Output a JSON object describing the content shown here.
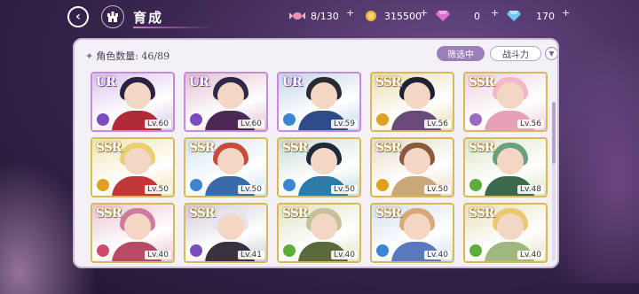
{
  "header": {
    "title": "育成",
    "resources": [
      {
        "name": "candy",
        "icon": "candy-icon",
        "value": "8/130",
        "color": "#f08fb0"
      },
      {
        "name": "gold",
        "icon": "gold-coin-icon",
        "value": "315500",
        "color": "#e8b53a"
      },
      {
        "name": "gem-pink",
        "icon": "pink-diamond-icon",
        "value": "0",
        "color": "#e070d0"
      },
      {
        "name": "gem-blue",
        "icon": "blue-diamond-icon",
        "value": "170",
        "color": "#6cc8f0"
      }
    ],
    "plus": "+"
  },
  "panel": {
    "count_label": "角色数量: 46/89",
    "filter_label": "筛选中",
    "power_label": "战斗力"
  },
  "cards": [
    {
      "rarity": "UR",
      "level": "Lv.60",
      "element": "#7a4cc0",
      "bg": "#d9c4ea",
      "hair": "#2a2240",
      "outfit": "#b02a3a"
    },
    {
      "rarity": "UR",
      "level": "Lv.60",
      "element": "#7a4cc0",
      "bg": "#e2c0d0",
      "hair": "#30284a",
      "outfit": "#4a2a55"
    },
    {
      "rarity": "UR",
      "level": "Lv.59",
      "element": "#3a86d0",
      "bg": "#c4d4ea",
      "hair": "#2a2a30",
      "outfit": "#2e4c8a"
    },
    {
      "rarity": "SSR",
      "level": "Lv.56",
      "element": "#e0a020",
      "bg": "#e8dcae",
      "hair": "#1e2230",
      "outfit": "#6a4a7a"
    },
    {
      "rarity": "SSR",
      "level": "Lv.56",
      "element": "#9a6ac0",
      "bg": "#ecd2dc",
      "hair": "#f4b6c8",
      "outfit": "#e6a0b8"
    },
    {
      "rarity": "SSR",
      "level": "Lv.50",
      "element": "#e0a020",
      "bg": "#efe4b4",
      "hair": "#e8d070",
      "outfit": "#c23838"
    },
    {
      "rarity": "SSR",
      "level": "Lv.50",
      "element": "#3a86d0",
      "bg": "#d2e4f0",
      "hair": "#c84a3a",
      "outfit": "#3a6aa8"
    },
    {
      "rarity": "SSR",
      "level": "Lv.50",
      "element": "#3a86d0",
      "bg": "#c8dcd8",
      "hair": "#1c2a3a",
      "outfit": "#2c7aa8"
    },
    {
      "rarity": "SSR",
      "level": "Lv.50",
      "element": "#e0a020",
      "bg": "#e6dcc4",
      "hair": "#8a5a3a",
      "outfit": "#c8a878"
    },
    {
      "rarity": "SSR",
      "level": "Lv.48",
      "element": "#5cae3a",
      "bg": "#dce6c8",
      "hair": "#6aa080",
      "outfit": "#3a6a4a"
    },
    {
      "rarity": "SSR",
      "level": "Lv.40",
      "element": "#d04a6a",
      "bg": "#e8c4d4",
      "hair": "#d07aa0",
      "outfit": "#b84a68"
    },
    {
      "rarity": "SSR",
      "level": "Lv.41",
      "element": "#7a4cc0",
      "bg": "#d0cad8",
      "hair": "#e4e4ea",
      "outfit": "#3a3040"
    },
    {
      "rarity": "SSR",
      "level": "Lv.40",
      "element": "#5cae3a",
      "bg": "#dfe2c4",
      "hair": "#c8c098",
      "outfit": "#5a6a3a"
    },
    {
      "rarity": "SSR",
      "level": "Lv.40",
      "element": "#3a86d0",
      "bg": "#d4e0f0",
      "hair": "#d8a878",
      "outfit": "#5a78c0"
    },
    {
      "rarity": "SSR",
      "level": "Lv.40",
      "element": "#5cae3a",
      "bg": "#e8e0c0",
      "hair": "#e8c870",
      "outfit": "#a0b880"
    }
  ]
}
